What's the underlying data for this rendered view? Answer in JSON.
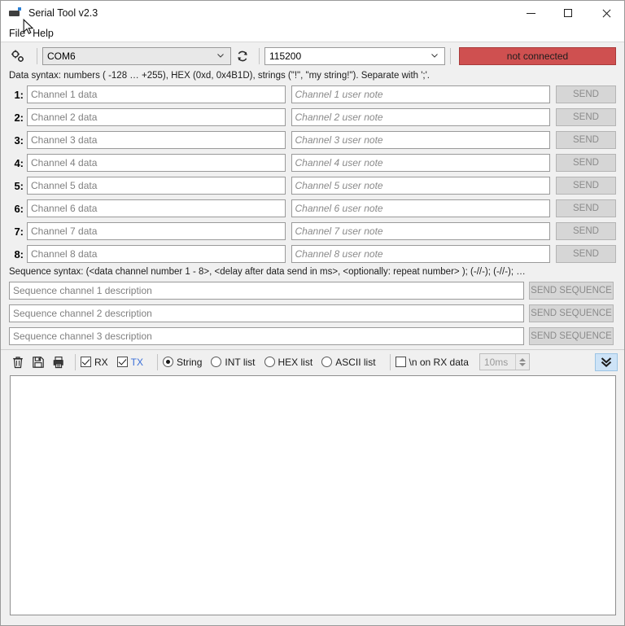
{
  "window": {
    "title": "Serial Tool v2.3",
    "icon": "serial-plug-icon",
    "minimize_label": "minimize",
    "maximize_label": "maximize",
    "close_label": "close"
  },
  "menu": {
    "items": [
      {
        "label": "File"
      },
      {
        "label": "Help"
      }
    ]
  },
  "connection": {
    "settings_icon": "gears-icon",
    "port": "COM6",
    "port_options": [
      "COM6"
    ],
    "refresh_icon": "refresh-icon",
    "baud": "115200",
    "baud_options": [
      "115200"
    ],
    "status": "not connected",
    "status_color": "#cf5050"
  },
  "data_hint": "Data syntax: numbers ( -128 … +255), HEX (0xd, 0x4B1D), strings (\"!\", \"my string!\"). Separate with ';'.",
  "channels": [
    {
      "num": "1:",
      "data_placeholder": "Channel 1 data",
      "note_placeholder": "Channel 1 user note",
      "send_label": "SEND"
    },
    {
      "num": "2:",
      "data_placeholder": "Channel 2 data",
      "note_placeholder": "Channel 2 user note",
      "send_label": "SEND"
    },
    {
      "num": "3:",
      "data_placeholder": "Channel 3 data",
      "note_placeholder": "Channel 3 user note",
      "send_label": "SEND"
    },
    {
      "num": "4:",
      "data_placeholder": "Channel 4 data",
      "note_placeholder": "Channel 4 user note",
      "send_label": "SEND"
    },
    {
      "num": "5:",
      "data_placeholder": "Channel 5 data",
      "note_placeholder": "Channel 5 user note",
      "send_label": "SEND"
    },
    {
      "num": "6:",
      "data_placeholder": "Channel 6 data",
      "note_placeholder": "Channel 6 user note",
      "send_label": "SEND"
    },
    {
      "num": "7:",
      "data_placeholder": "Channel 7 data",
      "note_placeholder": "Channel 7 user note",
      "send_label": "SEND"
    },
    {
      "num": "8:",
      "data_placeholder": "Channel 8 data",
      "note_placeholder": "Channel 8 user note",
      "send_label": "SEND"
    }
  ],
  "sequence_hint": "Sequence syntax: (<data channel number 1 - 8>, <delay after data send in ms>, <optionally: repeat number> ); (-//-); (-//-); …",
  "sequences": [
    {
      "placeholder": "Sequence channel 1 description",
      "send_label": "SEND SEQUENCE"
    },
    {
      "placeholder": "Sequence channel 2 description",
      "send_label": "SEND SEQUENCE"
    },
    {
      "placeholder": "Sequence channel 3 description",
      "send_label": "SEND SEQUENCE"
    }
  ],
  "toolbar": {
    "clear_icon": "trash-icon",
    "save_icon": "floppy-disk-icon",
    "export_icon": "print-icon",
    "rx": {
      "label": "RX",
      "checked": true
    },
    "tx": {
      "label": "TX",
      "checked": true
    },
    "display_modes": [
      {
        "label": "String",
        "selected": true
      },
      {
        "label": "INT list",
        "selected": false
      },
      {
        "label": "HEX list",
        "selected": false
      },
      {
        "label": "ASCII list",
        "selected": false
      }
    ],
    "newline_on_rx": {
      "label": "\\n on RX data",
      "checked": false
    },
    "timeout": {
      "value": "10ms",
      "enabled": false
    },
    "expand_icon": "double-chevron-down-icon"
  },
  "log": {
    "content": ""
  }
}
